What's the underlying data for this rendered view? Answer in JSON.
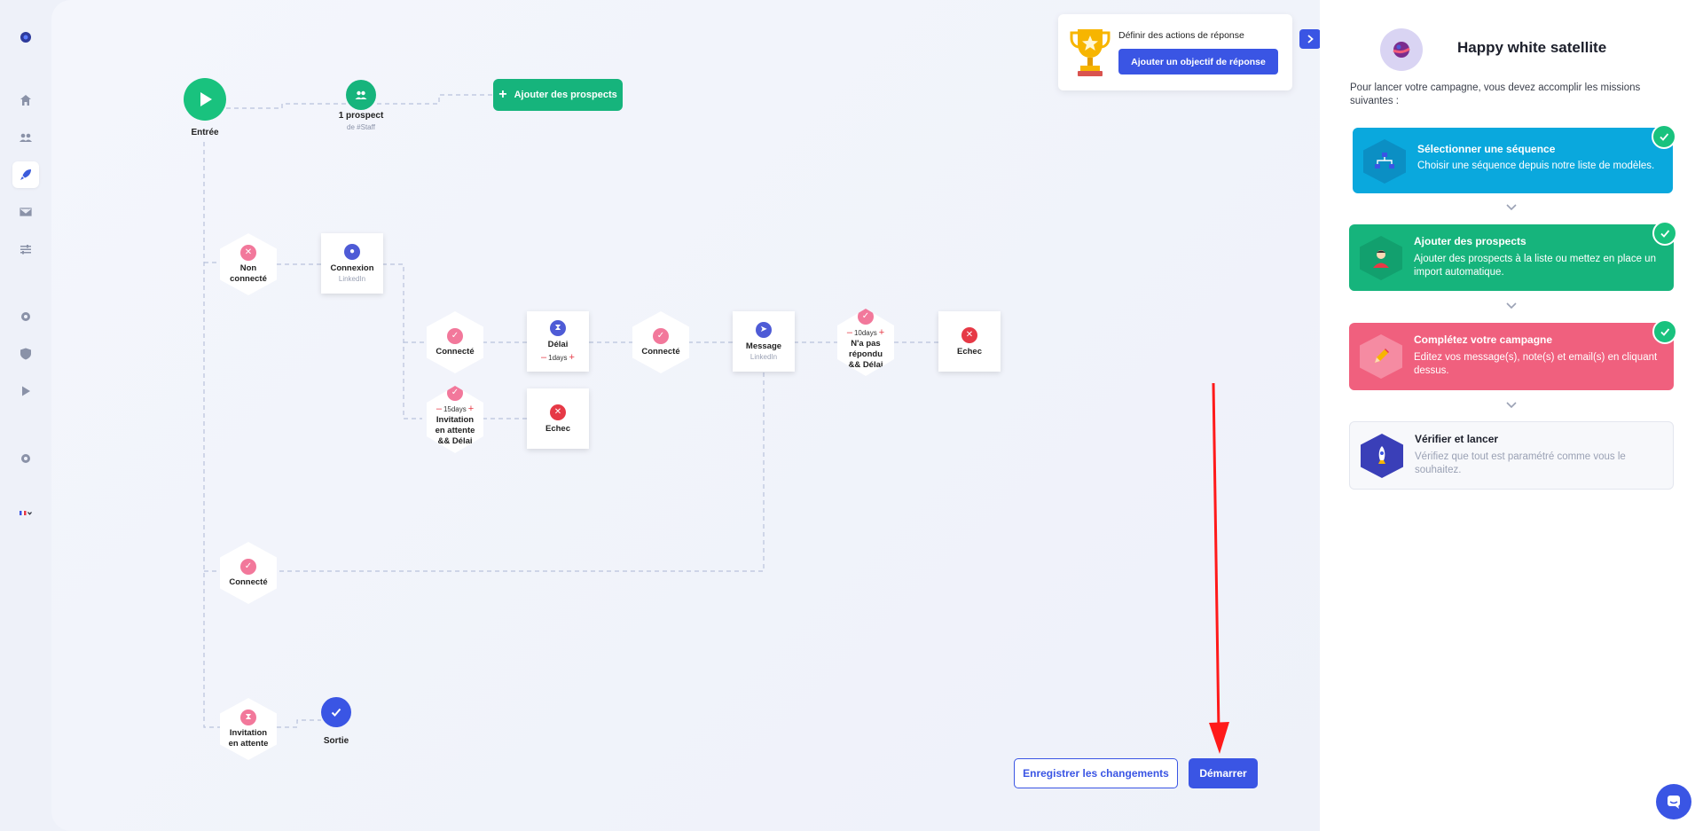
{
  "canvas": {
    "entry_label": "Entrée",
    "prospect_count": "1 prospect",
    "prospect_source": "de #Staff",
    "add_prospects_label": "Ajouter des prospects",
    "nodes": {
      "non_connecte": "Non connecté",
      "connexion": "Connexion",
      "connexion_sub": "LinkedIn",
      "connecte_1": "Connecté",
      "delai": "Délai",
      "delai_value": "1days",
      "connecte_2": "Connecté",
      "message": "Message",
      "message_sub": "LinkedIn",
      "npr_value": "10days",
      "npr_label": "N'a pas répondu && Délai",
      "echec_1": "Echec",
      "invitation_value": "15days",
      "invitation_label": "Invitation en attente && Délai",
      "echec_2": "Echec",
      "connecte_3": "Connecté",
      "invitation_attente": "Invitation en attente",
      "sortie": "Sortie"
    },
    "goal": {
      "title": "Définir des actions de réponse",
      "button": "Ajouter un objectif de réponse"
    },
    "save_button": "Enregistrer les changements",
    "start_button": "Démarrer"
  },
  "panel": {
    "campaign_name": "Happy white satellite",
    "intro": "Pour lancer votre campagne, vous devez accomplir les missions suivantes :",
    "missions": [
      {
        "title": "Sélectionner une séquence",
        "desc": "Choisir une séquence depuis notre liste de modèles.",
        "color": "#0aa8dd",
        "done": true
      },
      {
        "title": "Ajouter des prospects",
        "desc": "Ajouter des prospects à la liste ou mettez en place un import automatique.",
        "color": "#16b47c",
        "done": true
      },
      {
        "title": "Complétez votre campagne",
        "desc": "Editez vos message(s), note(s) et email(s) en cliquant dessus.",
        "color": "#f0607e",
        "done": true
      },
      {
        "title": "Vérifier et lancer",
        "desc": "Vérifiez que tout est paramétré comme vous le souhaitez.",
        "color": "#f7f8fb",
        "done": false
      }
    ]
  },
  "sidebar": {
    "icons": [
      "logo-icon",
      "home-icon",
      "users-icon",
      "rocket-icon",
      "mail-icon",
      "sliders-icon",
      "gear-icon",
      "shield-icon",
      "play-icon",
      "settings-icon",
      "flag-fr-icon"
    ]
  },
  "colors": {
    "primary": "#3a55e4",
    "green": "#16b47c",
    "pink": "#f2789b",
    "red": "#e63946",
    "cyan": "#0aa8dd"
  }
}
